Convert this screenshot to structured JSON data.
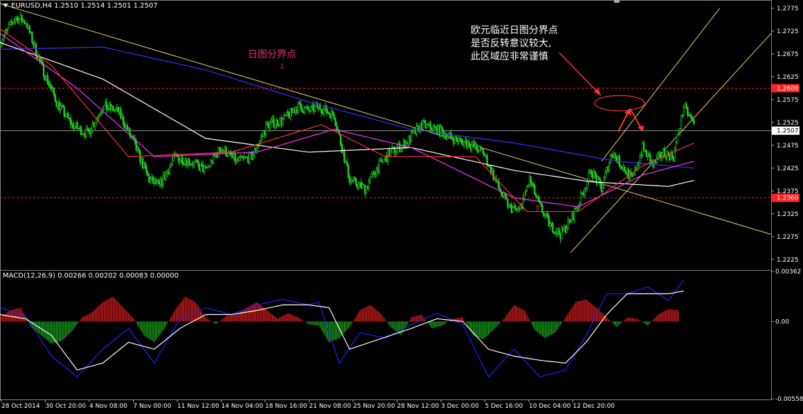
{
  "header": {
    "symbol": "EURUSD,H4",
    "ohlc": "1.2510 1.2514 1.2501 1.2507"
  },
  "annotations": {
    "main_lines": [
      "欧元临近日图分界点",
      "是否反转意议较大,",
      "此区域应非常谨慎"
    ],
    "pivot_label": "日图分界点",
    "colors": {
      "pivot_label": "#e0306a",
      "arrows": "#ff3333",
      "resistance": "#ff3333",
      "support": "#ff3333"
    }
  },
  "chart_data": [
    {
      "type": "candlestick",
      "instrument": "EURUSD",
      "timeframe": "H4",
      "y_ticks": [
        "1.2775",
        "1.2725",
        "1.2675",
        "1.2625",
        "1.2575",
        "1.2525",
        "1.2475",
        "1.2425",
        "1.2375",
        "1.2325",
        "1.2275",
        "1.2225"
      ],
      "ylim": [
        1.2205,
        1.279
      ],
      "x_ticks": [
        "28 Oct 2014",
        "30 Oct 20:00",
        "4 Nov 08:00",
        "7 Nov 00:00",
        "11 Nov 12:00",
        "14 Nov 04:00",
        "18 Nov 16:00",
        "21 Nov 08:00",
        "25 Nov 20:00",
        "28 Nov 12:00",
        "3 Dec 00:00",
        "5 Dec 16:00",
        "10 Dec 04:00",
        "12 Dec 20:00"
      ],
      "current_price": {
        "label": "1.2507",
        "value": 1.2507
      },
      "horizontal_levels": [
        {
          "label": "1.2600",
          "value": 1.26,
          "color": "#ff2222"
        },
        {
          "label": "1.2360",
          "value": 1.236,
          "color": "#ff2222"
        }
      ],
      "close_path": [
        [
          0,
          1.27
        ],
        [
          6,
          1.2755
        ],
        [
          10,
          1.2745
        ],
        [
          16,
          1.265
        ],
        [
          22,
          1.257
        ],
        [
          28,
          1.252
        ],
        [
          34,
          1.25
        ],
        [
          40,
          1.256
        ],
        [
          46,
          1.255
        ],
        [
          52,
          1.248
        ],
        [
          58,
          1.24
        ],
        [
          62,
          1.2385
        ],
        [
          68,
          1.245
        ],
        [
          74,
          1.244
        ],
        [
          80,
          1.242
        ],
        [
          86,
          1.247
        ],
        [
          92,
          1.244
        ],
        [
          98,
          1.245
        ],
        [
          104,
          1.252
        ],
        [
          110,
          1.253
        ],
        [
          116,
          1.256
        ],
        [
          120,
          1.255
        ],
        [
          124,
          1.256
        ],
        [
          130,
          1.254
        ],
        [
          136,
          1.24
        ],
        [
          142,
          1.238
        ],
        [
          146,
          1.242
        ],
        [
          152,
          1.246
        ],
        [
          158,
          1.248
        ],
        [
          164,
          1.252
        ],
        [
          170,
          1.251
        ],
        [
          176,
          1.249
        ],
        [
          182,
          1.248
        ],
        [
          188,
          1.246
        ],
        [
          194,
          1.238
        ],
        [
          198,
          1.234
        ],
        [
          202,
          1.233
        ],
        [
          206,
          1.24
        ],
        [
          210,
          1.234
        ],
        [
          214,
          1.23
        ],
        [
          218,
          1.228
        ],
        [
          222,
          1.231
        ],
        [
          226,
          1.236
        ],
        [
          230,
          1.242
        ],
        [
          234,
          1.238
        ],
        [
          238,
          1.246
        ],
        [
          242,
          1.243
        ],
        [
          246,
          1.24
        ],
        [
          250,
          1.247
        ],
        [
          254,
          1.243
        ],
        [
          258,
          1.246
        ],
        [
          262,
          1.245
        ],
        [
          266,
          1.256
        ],
        [
          270,
          1.252
        ]
      ],
      "moving_averages": [
        {
          "color": "#3333ff",
          "values": [
            [
              0,
              1.2685
            ],
            [
              40,
              1.269
            ],
            [
              80,
              1.264
            ],
            [
              120,
              1.257
            ],
            [
              160,
              1.251
            ],
            [
              200,
              1.248
            ],
            [
              240,
              1.244
            ],
            [
              270,
              1.2425
            ]
          ]
        },
        {
          "color": "#ffffff",
          "values": [
            [
              0,
              1.27
            ],
            [
              40,
              1.262
            ],
            [
              80,
              1.249
            ],
            [
              120,
              1.246
            ],
            [
              160,
              1.247
            ],
            [
              200,
              1.242
            ],
            [
              230,
              1.2395
            ],
            [
              260,
              1.2385
            ],
            [
              270,
              1.2398
            ]
          ]
        },
        {
          "color": "#ff33ff",
          "values": [
            [
              0,
              1.272
            ],
            [
              30,
              1.26
            ],
            [
              60,
              1.245
            ],
            [
              100,
              1.246
            ],
            [
              130,
              1.251
            ],
            [
              160,
              1.247
            ],
            [
              200,
              1.236
            ],
            [
              225,
              1.234
            ],
            [
              250,
              1.241
            ],
            [
              270,
              1.244
            ]
          ]
        },
        {
          "color": "#ff3333",
          "values": [
            [
              0,
              1.273
            ],
            [
              20,
              1.265
            ],
            [
              50,
              1.245
            ],
            [
              90,
              1.246
            ],
            [
              125,
              1.252
            ],
            [
              150,
              1.245
            ],
            [
              185,
              1.245
            ],
            [
              205,
              1.233
            ],
            [
              225,
              1.233
            ],
            [
              250,
              1.243
            ],
            [
              270,
              1.248
            ]
          ]
        }
      ],
      "trendlines": [
        {
          "name": "descending",
          "color": "#f0d070",
          "from": [
            0,
            1.2785
          ],
          "to": [
            300,
            1.228
          ]
        },
        {
          "name": "channel-lower",
          "color": "#f0d070",
          "from": [
            222,
            1.224
          ],
          "to": [
            300,
            1.272
          ]
        },
        {
          "name": "channel-upper",
          "color": "#f0d070",
          "from": [
            234,
            1.244
          ],
          "to": [
            280,
            1.2775
          ]
        }
      ]
    },
    {
      "type": "histogram",
      "indicator": "MACD(12,26,9)",
      "values_label": "0.00266 0.00202 0.00083 0.00000",
      "y_ticks": [
        "0.00362",
        "0.00",
        "-0.00558"
      ],
      "ylim": [
        -0.00558,
        0.00362
      ],
      "histogram": [
        [
          0,
          0.0003
        ],
        [
          4,
          0.0008
        ],
        [
          8,
          0.001
        ],
        [
          12,
          -0.0004
        ],
        [
          16,
          -0.001
        ],
        [
          20,
          -0.0016
        ],
        [
          24,
          -0.0014
        ],
        [
          28,
          -0.0007
        ],
        [
          32,
          0.0003
        ],
        [
          36,
          0.0007
        ],
        [
          40,
          0.0014
        ],
        [
          44,
          0.0018
        ],
        [
          48,
          0.001
        ],
        [
          52,
          0.0002
        ],
        [
          56,
          -0.001
        ],
        [
          60,
          -0.0015
        ],
        [
          64,
          -0.0005
        ],
        [
          68,
          0.0008
        ],
        [
          72,
          0.0018
        ],
        [
          76,
          0.0014
        ],
        [
          80,
          0.0003
        ],
        [
          84,
          -0.0002
        ],
        [
          88,
          0.0004
        ],
        [
          92,
          0.0005
        ],
        [
          96,
          0.001
        ],
        [
          100,
          0.0014
        ],
        [
          104,
          0.0008
        ],
        [
          108,
          0.0002
        ],
        [
          112,
          0.0006
        ],
        [
          116,
          0.0003
        ],
        [
          120,
          -0.0002
        ],
        [
          124,
          -0.0003
        ],
        [
          128,
          -0.0015
        ],
        [
          132,
          -0.0012
        ],
        [
          136,
          -0.0004
        ],
        [
          140,
          0.0008
        ],
        [
          144,
          0.0012
        ],
        [
          148,
          0.0006
        ],
        [
          152,
          -0.0004
        ],
        [
          156,
          -0.001
        ],
        [
          160,
          0.0003
        ],
        [
          164,
          0.0005
        ],
        [
          168,
          -0.0005
        ],
        [
          172,
          -0.0003
        ],
        [
          176,
          0.0002
        ],
        [
          180,
          0.0003
        ],
        [
          184,
          -0.001
        ],
        [
          188,
          -0.0013
        ],
        [
          192,
          -0.0006
        ],
        [
          196,
          0.0002
        ],
        [
          200,
          0.0012
        ],
        [
          204,
          0.0008
        ],
        [
          208,
          -0.0006
        ],
        [
          212,
          -0.0012
        ],
        [
          216,
          -0.0008
        ],
        [
          220,
          0.0003
        ],
        [
          224,
          0.0014
        ],
        [
          228,
          0.0016
        ],
        [
          232,
          0.001
        ],
        [
          236,
          0.0003
        ],
        [
          240,
          -0.0004
        ],
        [
          244,
          0.0003
        ],
        [
          248,
          0.0002
        ],
        [
          252,
          -0.0003
        ],
        [
          256,
          0.0005
        ],
        [
          260,
          0.0009
        ],
        [
          264,
          0.0008
        ]
      ],
      "macd_line": [
        [
          0,
          0.001
        ],
        [
          10,
          0.0004
        ],
        [
          20,
          -0.0025
        ],
        [
          30,
          -0.004
        ],
        [
          40,
          -0.002
        ],
        [
          50,
          -0.0005
        ],
        [
          60,
          -0.003
        ],
        [
          70,
          0.0002
        ],
        [
          80,
          0.001
        ],
        [
          90,
          0.0005
        ],
        [
          100,
          0.0012
        ],
        [
          110,
          0.0016
        ],
        [
          120,
          0.0012
        ],
        [
          124,
          0.0014
        ],
        [
          132,
          -0.003
        ],
        [
          140,
          -0.0008
        ],
        [
          150,
          -0.0012
        ],
        [
          160,
          -0.0002
        ],
        [
          170,
          0.0006
        ],
        [
          180,
          -0.0002
        ],
        [
          190,
          -0.004
        ],
        [
          200,
          -0.002
        ],
        [
          210,
          -0.004
        ],
        [
          220,
          -0.0035
        ],
        [
          228,
          -0.001
        ],
        [
          236,
          0.002
        ],
        [
          244,
          0.002
        ],
        [
          252,
          0.0025
        ],
        [
          260,
          0.0015
        ],
        [
          266,
          0.003
        ]
      ],
      "signal_line": [
        [
          0,
          0.0005
        ],
        [
          10,
          0.0002
        ],
        [
          20,
          -0.001
        ],
        [
          30,
          -0.0035
        ],
        [
          40,
          -0.003
        ],
        [
          50,
          -0.0015
        ],
        [
          60,
          -0.002
        ],
        [
          70,
          -0.0005
        ],
        [
          80,
          0.0005
        ],
        [
          90,
          0.0005
        ],
        [
          100,
          0.0008
        ],
        [
          110,
          0.0012
        ],
        [
          120,
          0.0012
        ],
        [
          128,
          0.001
        ],
        [
          136,
          -0.002
        ],
        [
          144,
          -0.0015
        ],
        [
          152,
          -0.001
        ],
        [
          160,
          -0.0005
        ],
        [
          170,
          0.0002
        ],
        [
          180,
          0.0
        ],
        [
          190,
          -0.002
        ],
        [
          200,
          -0.0025
        ],
        [
          210,
          -0.0028
        ],
        [
          220,
          -0.003
        ],
        [
          228,
          -0.0015
        ],
        [
          236,
          0.0005
        ],
        [
          244,
          0.002
        ],
        [
          252,
          0.002
        ],
        [
          260,
          0.002
        ],
        [
          266,
          0.0022
        ]
      ],
      "colors": {
        "positive": "#ff2222",
        "negative": "#20c020",
        "macd": "#2020ff",
        "signal": "#ffffff"
      }
    }
  ]
}
